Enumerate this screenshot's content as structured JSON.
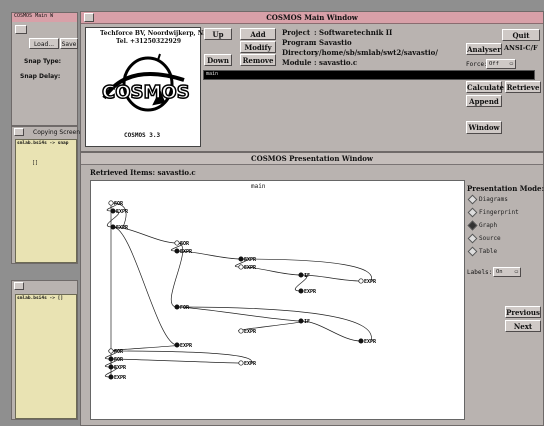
{
  "colors": {
    "main_titlebar": "#d8a0a8",
    "presentation_titlebar": "#c5bebb",
    "desktop": "#8f8f8f",
    "xterm_bg": "#e9e3b3",
    "module_field_bg": "#000000"
  },
  "left_panel": {
    "title": "COSMOS Main W",
    "load_button": "Load...",
    "save_button": "Save",
    "snap_type_label": "Snap Type:",
    "snap_delay_label": "Snap Delay:"
  },
  "copying_window": {
    "title": "Copying Screen..",
    "prompt": "smlab.bsi4s -> snap",
    "cursor": "[]"
  },
  "xterm2": {
    "prompt": "smlab.bsi4s -> []"
  },
  "main_window": {
    "title": "COSMOS Main Window",
    "logo": {
      "company": "Techforce BV, Noordwijkerp, NL",
      "phone": "Tel. +31250322929",
      "version": "COSMOS 3.3",
      "wordmark": "COSMOS"
    },
    "buttons": {
      "up": "Up",
      "add": "Add",
      "modify": "Modify",
      "down": "Down",
      "remove": "Remove",
      "quit": "Quit",
      "analyser": "Analyser",
      "calculate": "Calculate",
      "retrieve": "Retrieve",
      "append": "Append",
      "window": "Window"
    },
    "project_label": "Project",
    "project_value": ": Softwaretechnik II",
    "program_label": "Program",
    "program_value": ": Savastio",
    "directory_label": "Directory",
    "directory_value": ": /home/sb/smlab/swt2/savastio/",
    "module_label": "Module",
    "module_value": ": savastio.c",
    "command_field": "main",
    "language": "ANSI-C/F",
    "force_label": "Force:",
    "force_value": "Off"
  },
  "presentation_window": {
    "title": "COSMOS Presentation Window",
    "retrieved_label": "Retrieved Items: savastio.c",
    "graph_title": "main",
    "mode_label": "Presentation Mode:",
    "modes": [
      {
        "label": "Diagrams",
        "selected": false
      },
      {
        "label": "Fingerprint",
        "selected": false
      },
      {
        "label": "Graph",
        "selected": true
      },
      {
        "label": "Source",
        "selected": false
      },
      {
        "label": "Table",
        "selected": false
      }
    ],
    "labels_label": "Labels:",
    "labels_value": "On",
    "previous_button": "Previous",
    "next_button": "Next"
  },
  "graph_nodes": [
    {
      "label": "FOR"
    },
    {
      "label": "EXPR"
    },
    {
      "label": "EXPR"
    },
    {
      "label": "FOR"
    },
    {
      "label": "EXPR"
    },
    {
      "label": "EXPR"
    },
    {
      "label": "EXPR"
    },
    {
      "label": "IF"
    },
    {
      "label": "EXPR"
    },
    {
      "label": "EXPR"
    },
    {
      "label": "FOR"
    },
    {
      "label": "IF"
    },
    {
      "label": "EXPR"
    },
    {
      "label": "EXPR"
    },
    {
      "label": "EXPR"
    },
    {
      "label": "FOR"
    },
    {
      "label": "FOR"
    },
    {
      "label": "EXPR"
    },
    {
      "label": "EXPR"
    },
    {
      "label": "EXPR"
    }
  ]
}
